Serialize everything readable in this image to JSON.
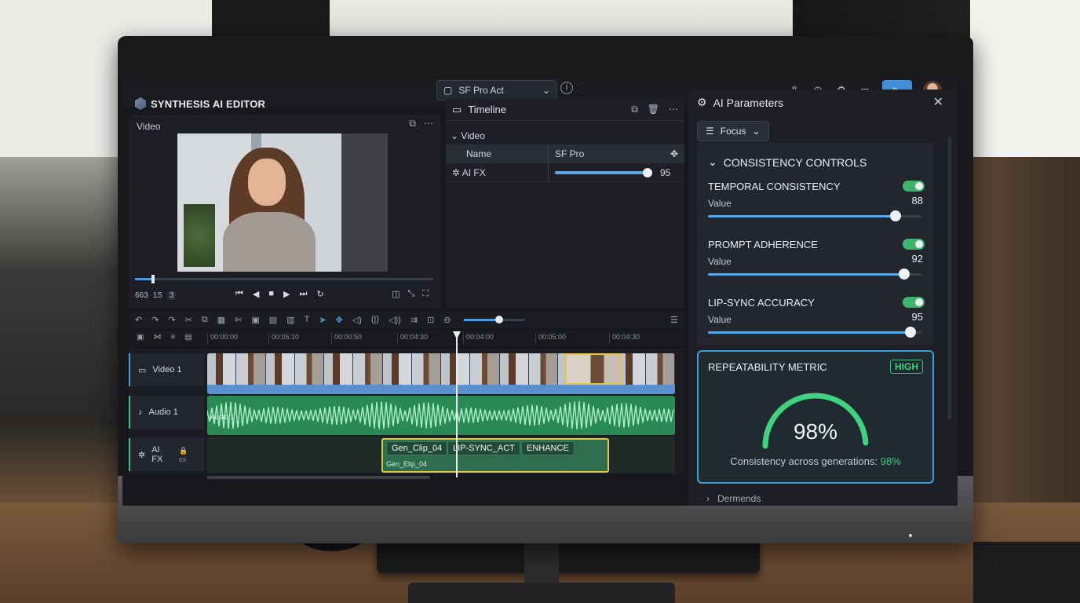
{
  "app": {
    "brand": "SYNTHESIS AI EDITOR",
    "font_selector": "SF Pro Act"
  },
  "video_panel": {
    "label": "Video",
    "timecode": "663",
    "timecode_unit": "1S",
    "timecode_badge": "3",
    "progress": 0.06
  },
  "timeline_panel": {
    "title": "Timeline",
    "section": "Video",
    "header": {
      "name": "Name",
      "value": "SF Pro"
    },
    "rows": [
      {
        "name": "AI FX",
        "value": "95",
        "level": 0.95
      }
    ]
  },
  "ruler": {
    "ticks": [
      "00:00:00",
      "00:05:10",
      "00:00:50",
      "00:04:30",
      "00:04:00",
      "00:05:00",
      "00:04:30"
    ]
  },
  "tracks": [
    {
      "label": "Video 1"
    },
    {
      "label": "Audio 1",
      "clip": "Audio 1"
    },
    {
      "label": "AI FX",
      "lock_suffix": "cs"
    }
  ],
  "fx_clip": {
    "chips": [
      "Gen_Clip_04",
      "LIP-SYNC_ACT",
      "ENHANCE"
    ],
    "sub": "Gen_Elip_04"
  },
  "zoom_level": 0.58,
  "ai_panel": {
    "title": "AI Parameters",
    "focus_label": "Focus",
    "consistency": {
      "title": "CONSISTENCY CONTROLS",
      "controls": [
        {
          "name": "TEMPORAL CONSISTENCY",
          "sub": "Value",
          "value": "88",
          "level": 0.88,
          "on": true
        },
        {
          "name": "PROMPT ADHERENCE",
          "sub": "Value",
          "value": "92",
          "level": 0.92,
          "on": true
        },
        {
          "name": "LIP-SYNC ACCURACY",
          "sub": "Value",
          "value": "95",
          "level": 0.95,
          "on": true
        }
      ]
    },
    "repeatability": {
      "title": "REPEATABILITY METRIC",
      "badge": "HIGH",
      "percent_text": "98%",
      "level": 0.98,
      "footer": "Consistency across generations:",
      "footer_value": "98%"
    },
    "collapsed_section": "Dermends"
  },
  "colors": {
    "accent": "#3f8fd8",
    "success": "#3fbf7a",
    "highlight": "#e0c84a"
  }
}
